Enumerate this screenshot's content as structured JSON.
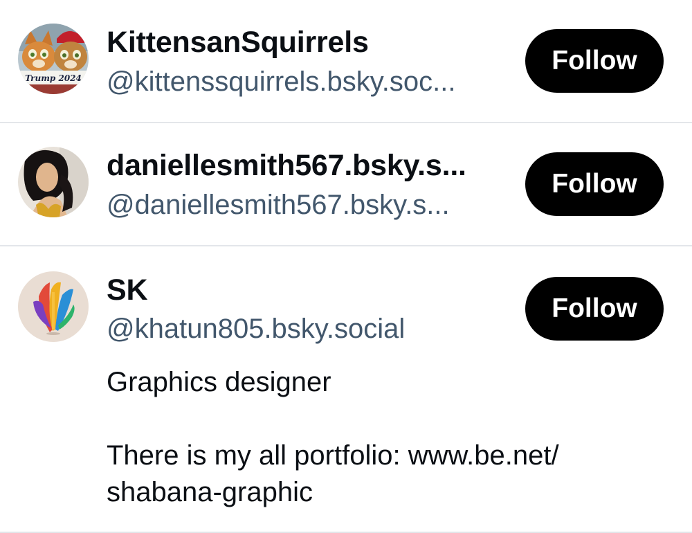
{
  "accounts": [
    {
      "display_name": "KittensanSquirrels",
      "handle": "@kittenssquirrels.bsky.soc...",
      "follow_label": "Follow",
      "avatar_text": "Trump 2024",
      "avatar_icon": "cats-avatar-icon"
    },
    {
      "display_name": "daniellesmith567.bsky.s...",
      "handle": "@daniellesmith567.bsky.s...",
      "follow_label": "Follow",
      "avatar_icon": "portrait-avatar-icon"
    },
    {
      "display_name": "SK",
      "handle": "@khatun805.bsky.social",
      "follow_label": "Follow",
      "avatar_icon": "feather-avatar-icon",
      "bio_line1": "Graphics designer",
      "bio_line2": "There is my all portfolio: www.be.net/ shabana-graphic"
    }
  ],
  "colors": {
    "button_bg": "#000000",
    "button_text": "#ffffff",
    "handle": "#42576c",
    "divider": "#e3e6ea"
  }
}
